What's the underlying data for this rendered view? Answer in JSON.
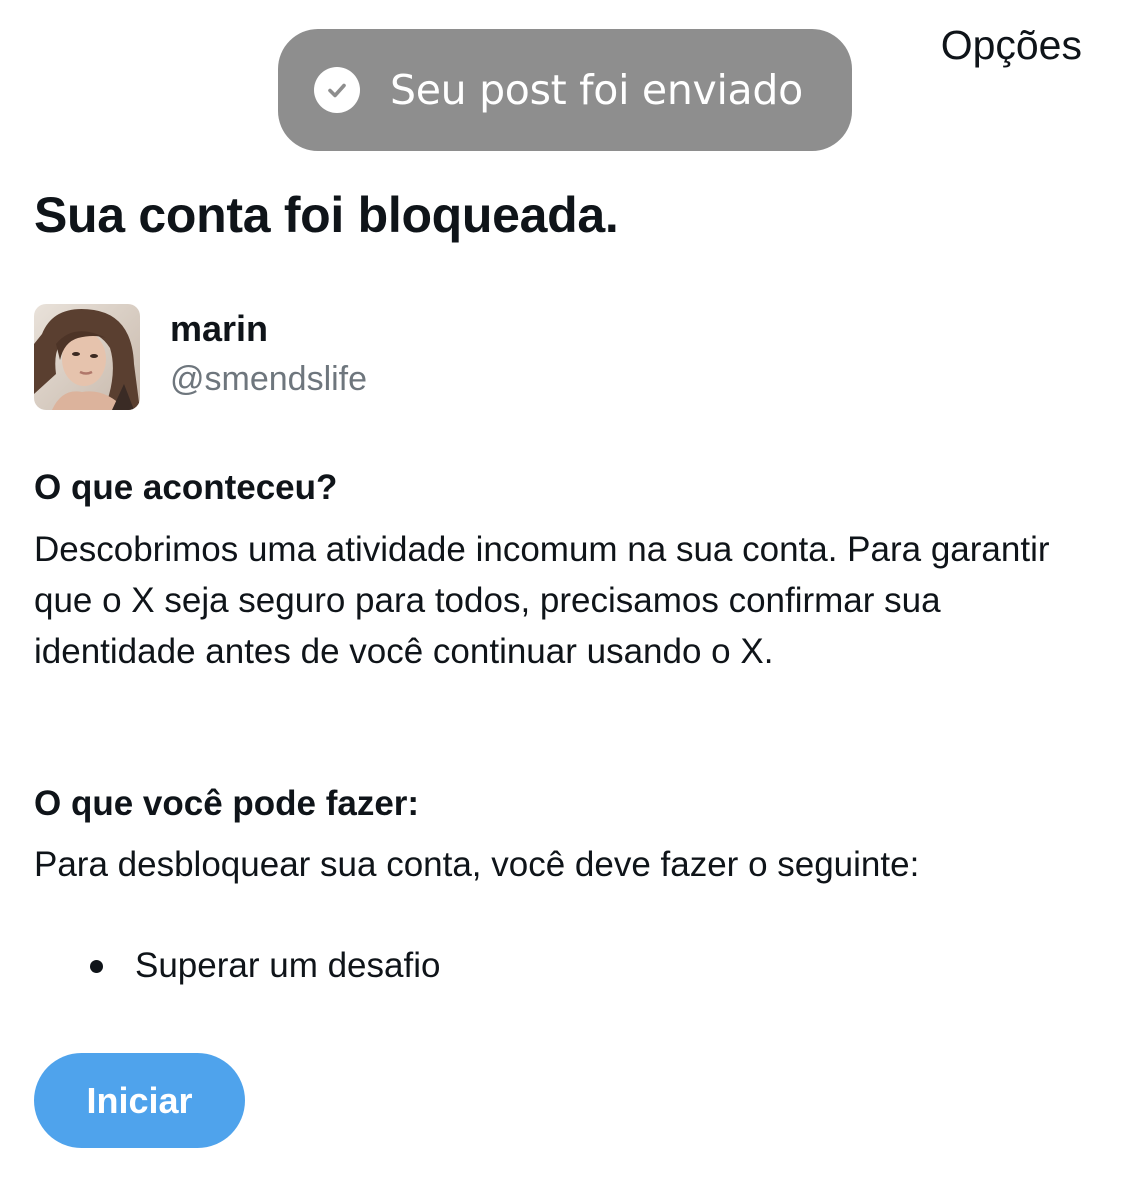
{
  "header": {
    "options_label": "Opções"
  },
  "toast": {
    "icon": "check-circle-icon",
    "message": "Seu post foi enviado"
  },
  "title": "Sua conta foi bloqueada.",
  "profile": {
    "display_name": "marin",
    "handle": "@smendslife"
  },
  "what_happened": {
    "heading": "O que aconteceu?",
    "body": "Descobrimos uma atividade incomum na sua conta. Para garantir que o X seja seguro para todos, precisamos confirmar sua identidade antes de você continuar usando o X."
  },
  "what_to_do": {
    "heading": "O que você pode fazer:",
    "body": "Para desbloquear sua conta, você deve fazer o seguinte:",
    "steps": [
      "Superar um desafio"
    ]
  },
  "start_button": {
    "label": "Iniciar"
  },
  "colors": {
    "accent": "#4fa3ec",
    "toast_bg": "#8e8e8e",
    "text": "#0f1419",
    "secondary_text": "#6e767d"
  }
}
